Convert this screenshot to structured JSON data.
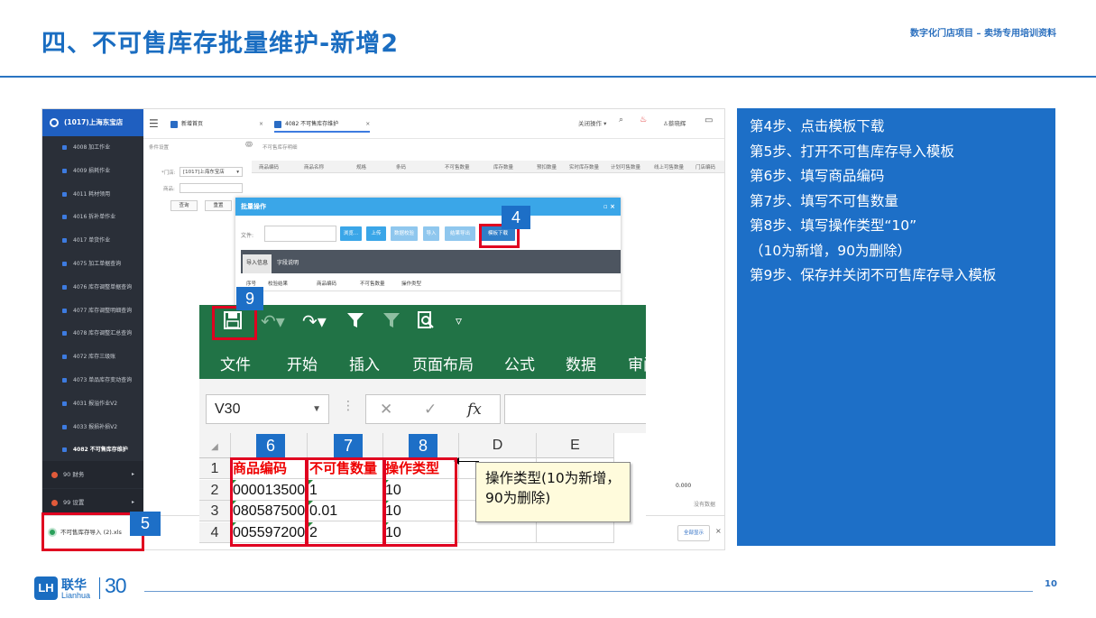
{
  "slide": {
    "title": "四、不可售库存批量维护-新增2",
    "subtitle": "数字化门店项目 – 卖场专用培训资料",
    "page_number": "10",
    "logo": {
      "mark": "LH",
      "cn": "联华",
      "en": "Lianhua",
      "anniversary": "30"
    }
  },
  "steps": [
    "第4步、点击模板下载",
    "第5步、打开不可售库存导入模板",
    "第6步、填写商品编码",
    "第7步、填写不可售数量",
    "第8步、填写操作类型“10”",
    "（10为新增，90为删除）",
    "第9步、保存并关闭不可售库存导入模板"
  ],
  "app": {
    "brand": "(1017)上海东宝店",
    "sidebar_items": [
      "4008 加工作业",
      "4009 损耗作业",
      "4011 耗材领用",
      "4016 拆补单作业",
      "4017 单货作业",
      "4075 加工单据查询",
      "4076 库存调整单据查询",
      "4077 库存调整明细查询",
      "4078 库存调整汇总查询",
      "4072 库存三级账",
      "4073 单品库存变动查询",
      "4031 报溢作业V2",
      "4033 报损补损V2",
      "4082 不可售库存维护"
    ],
    "sidebar_groups": [
      "90 财务",
      "99 设置"
    ],
    "tabs": [
      {
        "label": "新增首页"
      },
      {
        "label": "4082 不可售库存维护"
      }
    ],
    "topbar_right": {
      "close_ops": "关闭操作 ▾",
      "user": "蔡晓辉"
    },
    "left_form": {
      "cond_label": "条件设置",
      "result_label": "不可售库存明细",
      "store_label": "*门店:",
      "store_value": "[1017]上海东宝店",
      "product_label": "商品:",
      "query_btn": "查询",
      "reset_btn": "重置"
    },
    "grid_headers": [
      "商品编码",
      "商品名称",
      "规格",
      "条码",
      "不可售数量",
      "库存数量",
      "预扣数量",
      "实时库存数量",
      "计划可售数量",
      "线上可售数量",
      "门店编码"
    ],
    "modal": {
      "title": "批量操作",
      "file_label": "文件:",
      "buttons": [
        "浏览...",
        "上传",
        "数据校验",
        "导入",
        "结果导出",
        "模板下载"
      ],
      "tabs": [
        "导入信息",
        "字段说明"
      ],
      "subcols": [
        "序号",
        "校验结果",
        "商品编码",
        "不可售数量",
        "操作类型"
      ]
    },
    "downloads": {
      "file": "不可售库存导入 (2).xls",
      "show_all": "全部显示",
      "close": "×"
    },
    "right_values": {
      "total": "0.000",
      "nodata": "没有数据"
    }
  },
  "excel": {
    "ribbon_tabs": [
      "文件",
      "开始",
      "插入",
      "页面布局",
      "公式",
      "数据",
      "审阅"
    ],
    "name_box": "V30",
    "columns": [
      "A",
      "B",
      "C",
      "D",
      "E"
    ],
    "rows": [
      {
        "num": "1",
        "a": "商品编码",
        "b": "不可售数量",
        "c": "操作类型"
      },
      {
        "num": "2",
        "a": "000013500",
        "b": "1",
        "c": "10"
      },
      {
        "num": "3",
        "a": "080587500",
        "b": "0.01",
        "c": "10"
      },
      {
        "num": "4",
        "a": "005597200",
        "b": "2",
        "c": "10"
      }
    ],
    "comment": "操作类型(10为新增，90为删除)"
  },
  "badges": {
    "b4": "4",
    "b5": "5",
    "b6": "6",
    "b7": "7",
    "b8": "8",
    "b9": "9"
  }
}
